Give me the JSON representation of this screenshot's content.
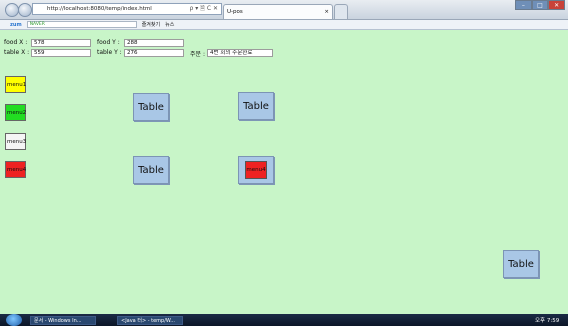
{
  "browser": {
    "url": "http://localhost:8080/temp/index.html",
    "address_controls": "ρ ▾ 🗎 C ✕",
    "tab_title": "U-pos",
    "tab_close": "×",
    "toolbar_brand": "zum",
    "search_value": "NAVER",
    "favorites_label": "즐겨찾기",
    "news_label": "뉴스"
  },
  "fields": {
    "food_x_label": "food X :",
    "food_x_value": "578",
    "food_y_label": "food Y :",
    "food_y_value": "288",
    "table_x_label": "table X :",
    "table_x_value": "559",
    "table_y_label": "table Y :",
    "table_y_value": "276",
    "order_label": "주문 :",
    "order_value": "4번 회의 주문완료"
  },
  "menus": [
    {
      "label": "menu1",
      "color": "#ffff00"
    },
    {
      "label": "menu2",
      "color": "#22dd22"
    },
    {
      "label": "menu3",
      "color": "#f5f5f5"
    },
    {
      "label": "menu4",
      "color": "#ee2222"
    }
  ],
  "tables": {
    "label": "Table",
    "occupied_label": "menu4",
    "occupied_color": "#ee2222"
  },
  "taskbar": {
    "items": [
      "문서 - Windows In...",
      "<Java 터> - temp/W..."
    ],
    "clock": "오후 7:59"
  },
  "colors": {
    "page_background": "#c8f5c8",
    "table_button": "#a9c7e6"
  }
}
